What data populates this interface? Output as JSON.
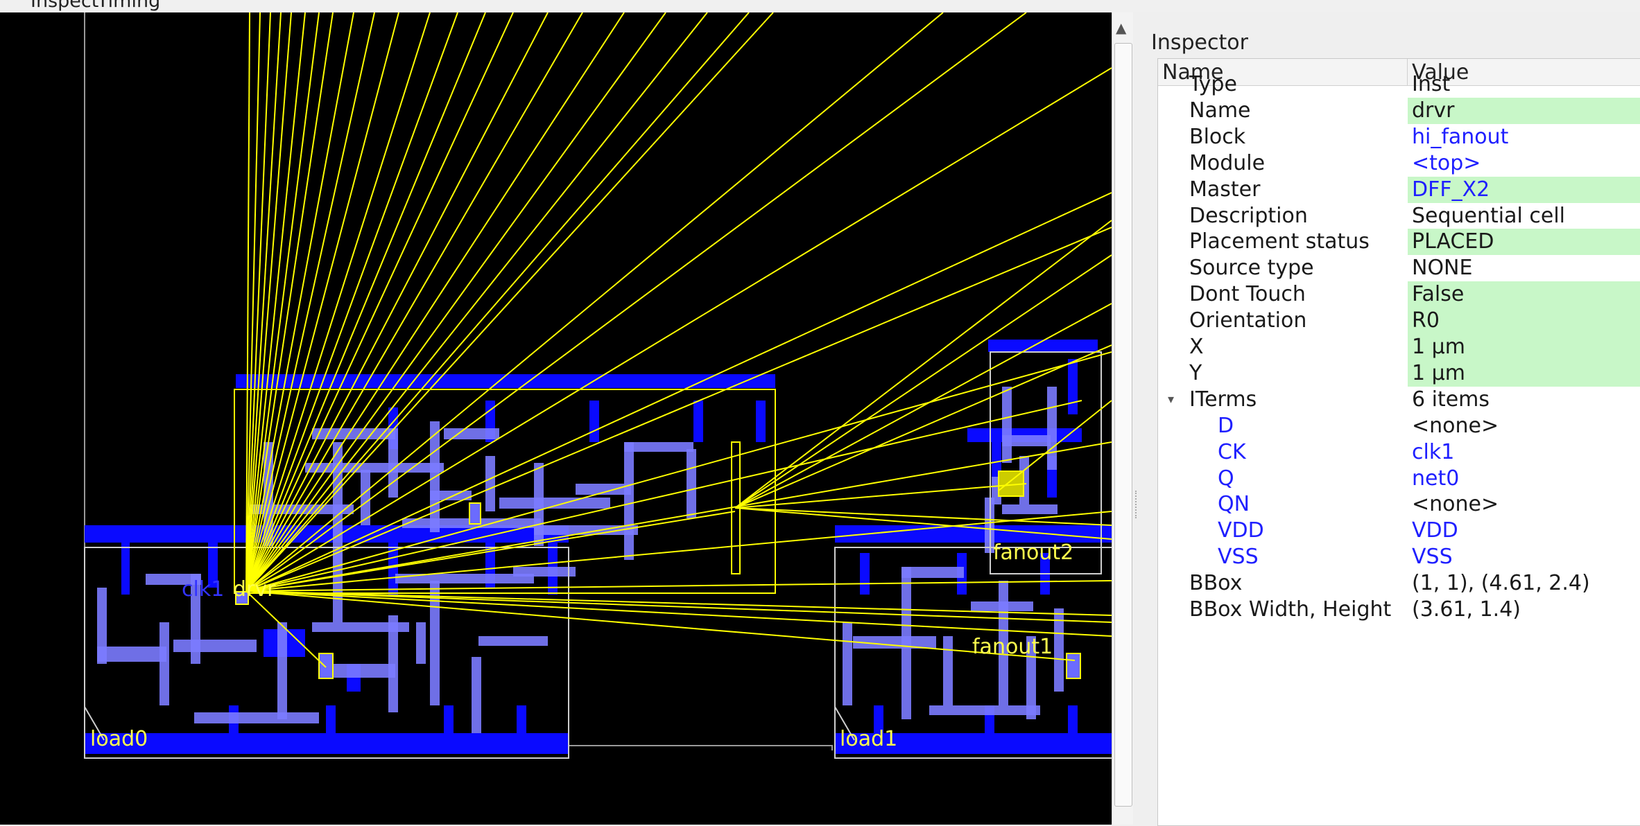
{
  "menubar": {
    "items": [
      "Inspect",
      "Timing"
    ]
  },
  "layout_labels": {
    "clk1": "clk1",
    "drvr": "drvr",
    "fanout1": "fanout1",
    "fanout2": "fanout2",
    "load0": "load0",
    "load1": "load1"
  },
  "colors": {
    "canvas_bg": "#000000",
    "metal_dark": "#0a0aff",
    "metal_light": "#7b7bff",
    "flightline": "#ffff00",
    "editable_bg": "#c8f7c8",
    "link_text": "#1f1fff"
  },
  "inspector": {
    "title": "Inspector",
    "columns": {
      "name": "Name",
      "value": "Value"
    },
    "rows": [
      {
        "key": "Type",
        "value": "Inst",
        "style": "plain"
      },
      {
        "key": "Name",
        "value": "drvr",
        "style": "edit"
      },
      {
        "key": "Block",
        "value": "hi_fanout",
        "style": "link"
      },
      {
        "key": "Module",
        "value": "<top>",
        "style": "link"
      },
      {
        "key": "Master",
        "value": "DFF_X2",
        "style": "edit-link"
      },
      {
        "key": "Description",
        "value": "Sequential cell",
        "style": "plain"
      },
      {
        "key": "Placement status",
        "value": "PLACED",
        "style": "edit"
      },
      {
        "key": "Source type",
        "value": "NONE",
        "style": "plain"
      },
      {
        "key": "Dont Touch",
        "value": "False",
        "style": "edit"
      },
      {
        "key": "Orientation",
        "value": "R0",
        "style": "edit"
      },
      {
        "key": "X",
        "value": "1 μm",
        "style": "edit"
      },
      {
        "key": "Y",
        "value": "1 μm",
        "style": "edit"
      },
      {
        "key": "ITerms",
        "value": "6 items",
        "style": "plain",
        "expander": "▾"
      },
      {
        "key": "D",
        "value": "<none>",
        "style": "plain",
        "child": true
      },
      {
        "key": "CK",
        "value": "clk1",
        "style": "link",
        "child": true
      },
      {
        "key": "Q",
        "value": "net0",
        "style": "link",
        "child": true
      },
      {
        "key": "QN",
        "value": "<none>",
        "style": "plain",
        "child": true
      },
      {
        "key": "VDD",
        "value": "VDD",
        "style": "link",
        "child": true
      },
      {
        "key": "VSS",
        "value": "VSS",
        "style": "link",
        "child": true
      },
      {
        "key": "BBox",
        "value": "(1, 1), (4.61, 2.4)",
        "style": "plain"
      },
      {
        "key": "BBox Width, Height",
        "value": "(3.61, 1.4)",
        "style": "plain"
      }
    ]
  },
  "scrollbar": {
    "up_arrow": "▲"
  }
}
